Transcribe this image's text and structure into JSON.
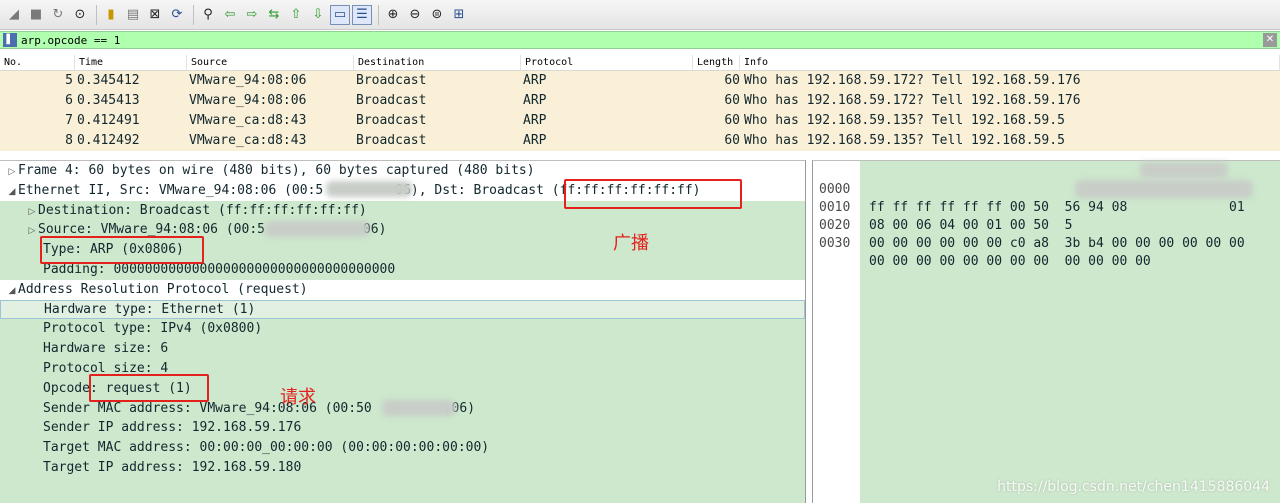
{
  "filter": {
    "value": "arp.opcode == 1"
  },
  "packet_list": {
    "columns": [
      "No.",
      "Time",
      "Source",
      "Destination",
      "Protocol",
      "Length",
      "Info"
    ],
    "rows": [
      {
        "no": "5",
        "time": "0.345412",
        "src": "VMware_94:08:06",
        "dst": "Broadcast",
        "proto": "ARP",
        "len": "60",
        "info": "Who has 192.168.59.172? Tell 192.168.59.176"
      },
      {
        "no": "6",
        "time": "0.345413",
        "src": "VMware_94:08:06",
        "dst": "Broadcast",
        "proto": "ARP",
        "len": "60",
        "info": "Who has 192.168.59.172? Tell 192.168.59.176"
      },
      {
        "no": "7",
        "time": "0.412491",
        "src": "VMware_ca:d8:43",
        "dst": "Broadcast",
        "proto": "ARP",
        "len": "60",
        "info": "Who has 192.168.59.135? Tell 192.168.59.5"
      },
      {
        "no": "8",
        "time": "0.412492",
        "src": "VMware_ca:d8:43",
        "dst": "Broadcast",
        "proto": "ARP",
        "len": "60",
        "info": "Who has 192.168.59.135? Tell 192.168.59.5"
      }
    ]
  },
  "details": {
    "frame": "Frame 4: 60 bytes on wire (480 bits), 60 bytes captured (480 bits)",
    "ethernet_prefix": "Ethernet II, Src: VMware_94:08:06 (00:5",
    "ethernet_mid": "06), Dst: Broadcast ",
    "ethernet_dst_mac": "(ff:ff:ff:ff:ff:ff)",
    "eth_destination": "Destination: Broadcast (ff:ff:ff:ff:ff:ff)",
    "eth_source_prefix": "Source: VMware_94:08:06 (00:5",
    "eth_source_suffix": "06)",
    "eth_type": "Type: ARP (0x0806)",
    "eth_padding": "Padding: 000000000000000000000000000000000000",
    "arp": "Address Resolution Protocol (request)",
    "arp_hw_type": "Hardware type: Ethernet (1)",
    "arp_proto_type": "Protocol type: IPv4 (0x0800)",
    "arp_hw_size": "Hardware size: 6",
    "arp_proto_size": "Protocol size: 4",
    "arp_opcode_label": "Opcode",
    "arp_opcode_value": ": request (1)",
    "arp_sender_mac_prefix": "Sender MAC address: VMware_94:08:06 (00:50",
    "arp_sender_mac_suffix": ":06)",
    "arp_sender_ip": "Sender IP address: 192.168.59.176",
    "arp_target_mac": "Target MAC address: 00:00:00_00:00:00 (00:00:00:00:00:00)",
    "arp_target_ip": "Target IP address: 192.168.59.180"
  },
  "bytes": {
    "rows": [
      {
        "offset": "0000",
        "hex": "ff ff ff ff ff ff 00 50  56 94 08             01"
      },
      {
        "offset": "0010",
        "hex": "08 00 06 04 00 01 00 50  5"
      },
      {
        "offset": "0020",
        "hex": "00 00 00 00 00 00 c0 a8  3b b4 00 00 00 00 00 00"
      },
      {
        "offset": "0030",
        "hex": "00 00 00 00 00 00 00 00  00 00 00 00"
      }
    ]
  },
  "annotations": {
    "broadcast": "广播",
    "request": "请求"
  },
  "watermark": "https://blog.csdn.net/chen1415886044",
  "icons": [
    "shark-fin-start-icon",
    "stop-icon",
    "restart-icon",
    "options-icon",
    "open-icon",
    "save-icon",
    "close-icon",
    "reload-icon",
    "find-icon",
    "back-icon",
    "forward-icon",
    "goto-icon",
    "first-icon",
    "last-icon",
    "autoscroll-icon",
    "colorize-icon",
    "zoom-in-icon",
    "zoom-out-icon",
    "normal-size-icon",
    "resize-columns-icon"
  ]
}
